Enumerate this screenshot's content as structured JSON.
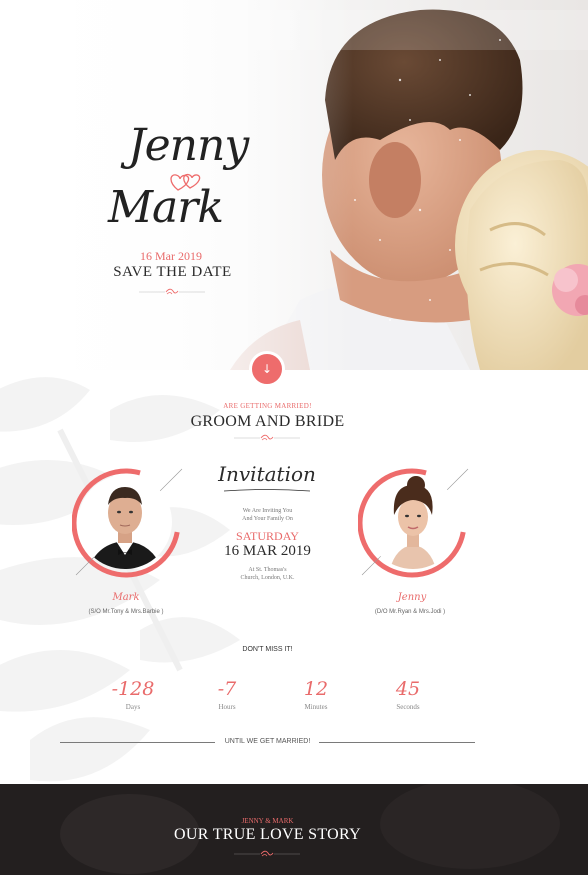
{
  "hero": {
    "name_groom_first": "Jenny",
    "name_second": "Mark",
    "date": "16 Mar 2019",
    "save_the_date": "SAVE THE DATE"
  },
  "scroll_button": {
    "icon": "arrow-down-icon",
    "glyph": "↓"
  },
  "couple_section": {
    "kicker": "ARE GETTING MARRIED!",
    "title": "GROOM AND BRIDE",
    "groom": {
      "name": "Mark",
      "parents": "(S/O Mr.Tony & Mrs.Barbie )"
    },
    "bride": {
      "name": "Jenny",
      "parents": "(D/O Mr.Ryan & Mrs.Jodi )"
    },
    "invitation": {
      "title": "Invitation",
      "line1": "We Are Inviting You",
      "line2": "And Your Family On",
      "day": "SATURDAY",
      "date": "16 MAR 2019",
      "venue1": "At St. Thomas's",
      "venue2": "Church, London, U.K."
    }
  },
  "countdown": {
    "heading": "DON'T MISS IT!",
    "items": [
      {
        "value": "-128",
        "label": "Days"
      },
      {
        "value": "-7",
        "label": "Hours"
      },
      {
        "value": "12",
        "label": "Minutes"
      },
      {
        "value": "45",
        "label": "Seconds"
      }
    ],
    "until": "UNTIL WE GET MARRIED!"
  },
  "story": {
    "kicker": "JENNY & MARK",
    "title": "OUR TRUE LOVE STORY"
  },
  "colors": {
    "accent": "#ee6c6c",
    "text_dark": "#2b2b2b",
    "story_bg": "#231f1f"
  }
}
